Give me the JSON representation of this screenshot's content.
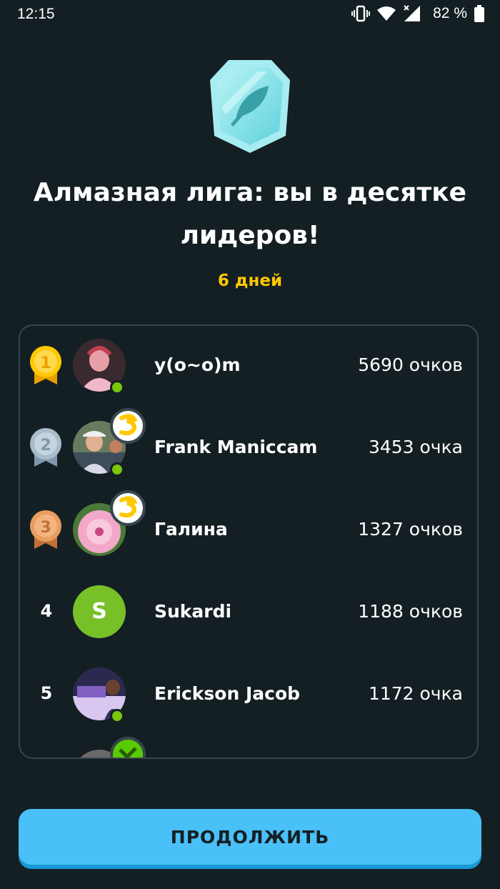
{
  "status_bar": {
    "time": "12:15",
    "battery": "82 %",
    "icons": [
      "vibrate-icon",
      "wifi-icon",
      "signal-icon",
      "battery-icon"
    ]
  },
  "league": {
    "badge_icon": "feather-icon",
    "title": "Алмазная лига: вы в десятке лидеров!",
    "time_left": "6 дней"
  },
  "leaderboard": [
    {
      "rank": "1",
      "medal": "gold",
      "name": "y(o~o)m",
      "xp": "5690 очков",
      "online": true,
      "streak_badge": false,
      "avatar": "photo"
    },
    {
      "rank": "2",
      "medal": "silver",
      "name": "Frank Maniccam",
      "xp": "3453 очка",
      "online": true,
      "streak_badge": true,
      "avatar": "photo"
    },
    {
      "rank": "3",
      "medal": "bronze",
      "name": "Галина",
      "xp": "1327 очков",
      "online": false,
      "streak_badge": true,
      "avatar": "photo"
    },
    {
      "rank": "4",
      "medal": null,
      "name": "Sukardi",
      "xp": "1188 очков",
      "online": false,
      "streak_badge": false,
      "avatar": "letter",
      "avatar_letter": "S"
    },
    {
      "rank": "5",
      "medal": null,
      "name": "Erickson Jacob",
      "xp": "1172 очка",
      "online": true,
      "streak_badge": false,
      "avatar": "photo"
    }
  ],
  "colors": {
    "background": "#141f23",
    "accent": "#49c0f8",
    "gold": "#ffc800",
    "online": "#7ac70c"
  },
  "continue_button": {
    "label": "ПРОДОЛЖИТЬ"
  }
}
